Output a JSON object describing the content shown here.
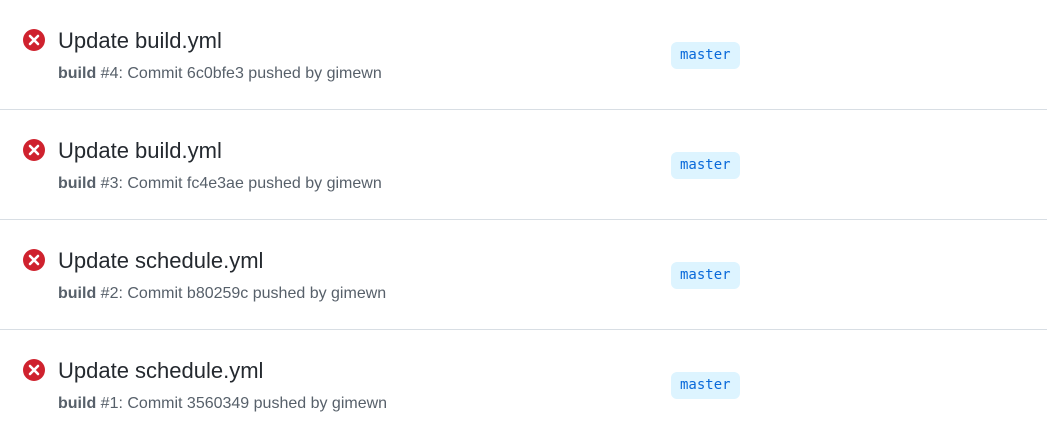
{
  "colors": {
    "failure_red": "#cf222e",
    "title_text": "#24292f",
    "meta_text": "#57606a",
    "branch_bg": "#ddf4ff",
    "branch_text": "#0969da",
    "divider": "#d8dee4"
  },
  "runs": [
    {
      "status": "failure",
      "status_icon": "x-circle-fill-icon",
      "title": "Update build.yml",
      "workflow": "build",
      "number_text": " #4: ",
      "detail": "Commit 6c0bfe3 pushed by gimewn",
      "branch": "master"
    },
    {
      "status": "failure",
      "status_icon": "x-circle-fill-icon",
      "title": "Update build.yml",
      "workflow": "build",
      "number_text": " #3: ",
      "detail": "Commit fc4e3ae pushed by gimewn",
      "branch": "master"
    },
    {
      "status": "failure",
      "status_icon": "x-circle-fill-icon",
      "title": "Update schedule.yml",
      "workflow": "build",
      "number_text": " #2: ",
      "detail": "Commit b80259c pushed by gimewn",
      "branch": "master"
    },
    {
      "status": "failure",
      "status_icon": "x-circle-fill-icon",
      "title": "Update schedule.yml",
      "workflow": "build",
      "number_text": " #1: ",
      "detail": "Commit 3560349 pushed by gimewn",
      "branch": "master"
    }
  ]
}
